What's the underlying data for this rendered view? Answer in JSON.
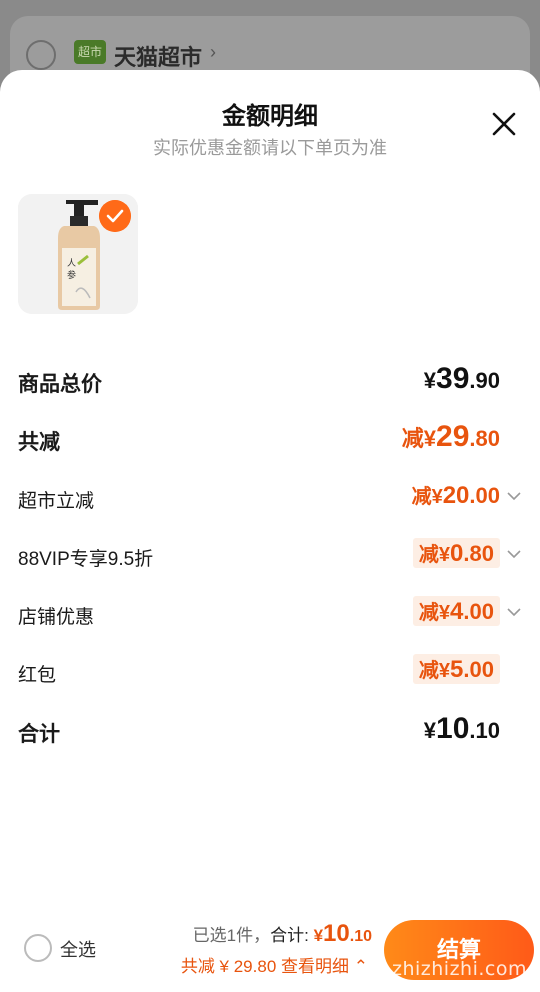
{
  "background": {
    "store_badge": "超市",
    "store_name": "天猫超市"
  },
  "sheet": {
    "title": "金额明细",
    "subtitle": "实际优惠金额请以下单页为准"
  },
  "rows": {
    "total_price": {
      "label": "商品总价",
      "currency": "¥",
      "int": "39",
      "dec": ".90"
    },
    "total_discount": {
      "label": "共减",
      "prefix": "减",
      "currency": "¥",
      "int": "29",
      "dec": ".80"
    },
    "supermarket_discount": {
      "label": "超市立减",
      "prefix": "减",
      "currency": "¥",
      "int": "20",
      "dec": ".00"
    },
    "vip_discount": {
      "label": "88VIP专享9.5折",
      "prefix": "减",
      "currency": "¥",
      "int": "0",
      "dec": ".80"
    },
    "store_discount": {
      "label": "店铺优惠",
      "prefix": "减",
      "currency": "¥",
      "int": "4",
      "dec": ".00"
    },
    "red_packet": {
      "label": "红包",
      "prefix": "减",
      "currency": "¥",
      "int": "5",
      "dec": ".00"
    },
    "subtotal": {
      "label": "合计",
      "currency": "¥",
      "int": "10",
      "dec": ".10"
    }
  },
  "footer": {
    "select_all": "全选",
    "selected_text": "已选1件，",
    "total_label": "合计: ",
    "total_currency": "¥",
    "total_int": "10",
    "total_dec": ".10",
    "discount_text": "共减 ¥ 29.80",
    "view_details": "查看明细",
    "view_details_icon": "chevron-up-icon",
    "checkout_label": "结算"
  },
  "watermark": "zhizhizhi.com",
  "colors": {
    "accent": "#e8540e",
    "button": "#ff6a18"
  }
}
